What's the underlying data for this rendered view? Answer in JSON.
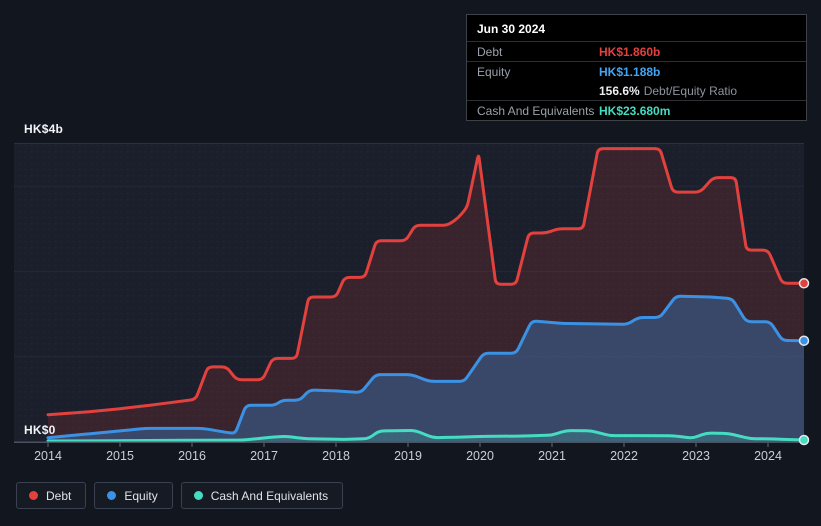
{
  "y_axis": {
    "top_label": "HK$4b",
    "zero_label": "HK$0"
  },
  "tooltip": {
    "date": "Jun 30 2024",
    "debt_label": "Debt",
    "debt_value": "HK$1.860b",
    "equity_label": "Equity",
    "equity_value": "HK$1.188b",
    "ratio_value": "156.6%",
    "ratio_label": "Debt/Equity Ratio",
    "cash_label": "Cash And Equivalents",
    "cash_value": "HK$23.680m"
  },
  "legend": {
    "debt": "Debt",
    "equity": "Equity",
    "cash": "Cash And Equivalents"
  },
  "colors": {
    "debt": "#e2413d",
    "debt_fill": "rgba(226,65,61,0.16)",
    "equity": "#3b92e4",
    "equity_tooltip": "#41a5f4",
    "equity_fill": "rgba(59,146,228,0.32)",
    "cash": "#45dcc2",
    "cash_fill": "rgba(69,220,194,0.20)",
    "background": "#12161f",
    "plot_background": "#1a1f2b",
    "gridline": "#232937",
    "plot_top_border": "#2c3340",
    "axis_line": "#4a5260",
    "x_tick_label": "#c9cfd7"
  },
  "chart_data": {
    "type": "area",
    "y_unit": "HK$ billions",
    "ylim": [
      0,
      4
    ],
    "x_range": [
      2014,
      2024.5
    ],
    "y_gridlines": [
      1,
      2,
      3
    ],
    "top_border_value": 3.5,
    "x_ticks": [
      {
        "year": 2014,
        "label": "2014"
      },
      {
        "year": 2015,
        "label": "2015"
      },
      {
        "year": 2016,
        "label": "2016"
      },
      {
        "year": 2017,
        "label": "2017"
      },
      {
        "year": 2018,
        "label": "2018"
      },
      {
        "year": 2019,
        "label": "2019"
      },
      {
        "year": 2020,
        "label": "2020"
      },
      {
        "year": 2021,
        "label": "2021"
      },
      {
        "year": 2022,
        "label": "2022"
      },
      {
        "year": 2023,
        "label": "2023"
      },
      {
        "year": 2024,
        "label": "2024"
      }
    ],
    "series": [
      {
        "name": "Debt",
        "color": "#e2413d",
        "fill": "rgba(226,65,61,0.16)",
        "end_value_label": "HK$1.860b",
        "points": [
          [
            2014,
            0.32
          ],
          [
            2014.5,
            0.35
          ],
          [
            2015,
            0.39
          ],
          [
            2015.5,
            0.44
          ],
          [
            2016.05,
            0.5
          ],
          [
            2016.22,
            0.88
          ],
          [
            2016.48,
            0.88
          ],
          [
            2016.62,
            0.73
          ],
          [
            2016.98,
            0.73
          ],
          [
            2017.12,
            0.98
          ],
          [
            2017.45,
            0.98
          ],
          [
            2017.62,
            1.7
          ],
          [
            2018,
            1.7
          ],
          [
            2018.12,
            1.93
          ],
          [
            2018.4,
            1.93
          ],
          [
            2018.56,
            2.36
          ],
          [
            2018.97,
            2.36
          ],
          [
            2019.1,
            2.54
          ],
          [
            2019.55,
            2.54
          ],
          [
            2019.7,
            2.63
          ],
          [
            2019.82,
            2.75
          ],
          [
            2019.98,
            3.38
          ],
          [
            2020.22,
            1.85
          ],
          [
            2020.5,
            1.85
          ],
          [
            2020.68,
            2.45
          ],
          [
            2020.92,
            2.45
          ],
          [
            2021.08,
            2.5
          ],
          [
            2021.43,
            2.5
          ],
          [
            2021.64,
            3.44
          ],
          [
            2022.5,
            3.44
          ],
          [
            2022.68,
            2.93
          ],
          [
            2023.06,
            2.93
          ],
          [
            2023.24,
            3.1
          ],
          [
            2023.55,
            3.1
          ],
          [
            2023.7,
            2.25
          ],
          [
            2024,
            2.25
          ],
          [
            2024.2,
            1.86
          ],
          [
            2024.5,
            1.86
          ]
        ]
      },
      {
        "name": "Equity",
        "color": "#3b92e4",
        "fill": "rgba(59,146,228,0.32)",
        "end_value_label": "HK$1.188b",
        "points": [
          [
            2014,
            0.05
          ],
          [
            2014.5,
            0.09
          ],
          [
            2015,
            0.13
          ],
          [
            2015.35,
            0.16
          ],
          [
            2016.15,
            0.16
          ],
          [
            2016.5,
            0.11
          ],
          [
            2016.6,
            0.1
          ],
          [
            2016.75,
            0.43
          ],
          [
            2017.15,
            0.43
          ],
          [
            2017.25,
            0.49
          ],
          [
            2017.5,
            0.49
          ],
          [
            2017.63,
            0.61
          ],
          [
            2018,
            0.6
          ],
          [
            2018.35,
            0.58
          ],
          [
            2018.55,
            0.79
          ],
          [
            2019.05,
            0.79
          ],
          [
            2019.3,
            0.71
          ],
          [
            2019.78,
            0.71
          ],
          [
            2020.05,
            1.04
          ],
          [
            2020.5,
            1.04
          ],
          [
            2020.72,
            1.42
          ],
          [
            2021.15,
            1.39
          ],
          [
            2022.05,
            1.38
          ],
          [
            2022.2,
            1.46
          ],
          [
            2022.5,
            1.46
          ],
          [
            2022.72,
            1.71
          ],
          [
            2023.2,
            1.7
          ],
          [
            2023.5,
            1.68
          ],
          [
            2023.7,
            1.41
          ],
          [
            2024.03,
            1.41
          ],
          [
            2024.2,
            1.19
          ],
          [
            2024.5,
            1.188
          ]
        ]
      },
      {
        "name": "Cash And Equivalents",
        "color": "#45dcc2",
        "fill": "rgba(69,220,194,0.20)",
        "end_value_label": "HK$23.680m",
        "points": [
          [
            2014,
            0.012
          ],
          [
            2015,
            0.016
          ],
          [
            2016,
            0.02
          ],
          [
            2016.7,
            0.022
          ],
          [
            2017.1,
            0.055
          ],
          [
            2017.3,
            0.068
          ],
          [
            2017.55,
            0.04
          ],
          [
            2018.1,
            0.03
          ],
          [
            2018.45,
            0.04
          ],
          [
            2018.6,
            0.13
          ],
          [
            2019.1,
            0.135
          ],
          [
            2019.35,
            0.05
          ],
          [
            2019.6,
            0.055
          ],
          [
            2020,
            0.065
          ],
          [
            2020.6,
            0.07
          ],
          [
            2021,
            0.08
          ],
          [
            2021.2,
            0.135
          ],
          [
            2021.55,
            0.13
          ],
          [
            2021.8,
            0.075
          ],
          [
            2022.7,
            0.072
          ],
          [
            2022.95,
            0.045
          ],
          [
            2023.15,
            0.105
          ],
          [
            2023.45,
            0.1
          ],
          [
            2023.75,
            0.04
          ],
          [
            2024.1,
            0.035
          ],
          [
            2024.5,
            0.024
          ]
        ]
      }
    ]
  }
}
